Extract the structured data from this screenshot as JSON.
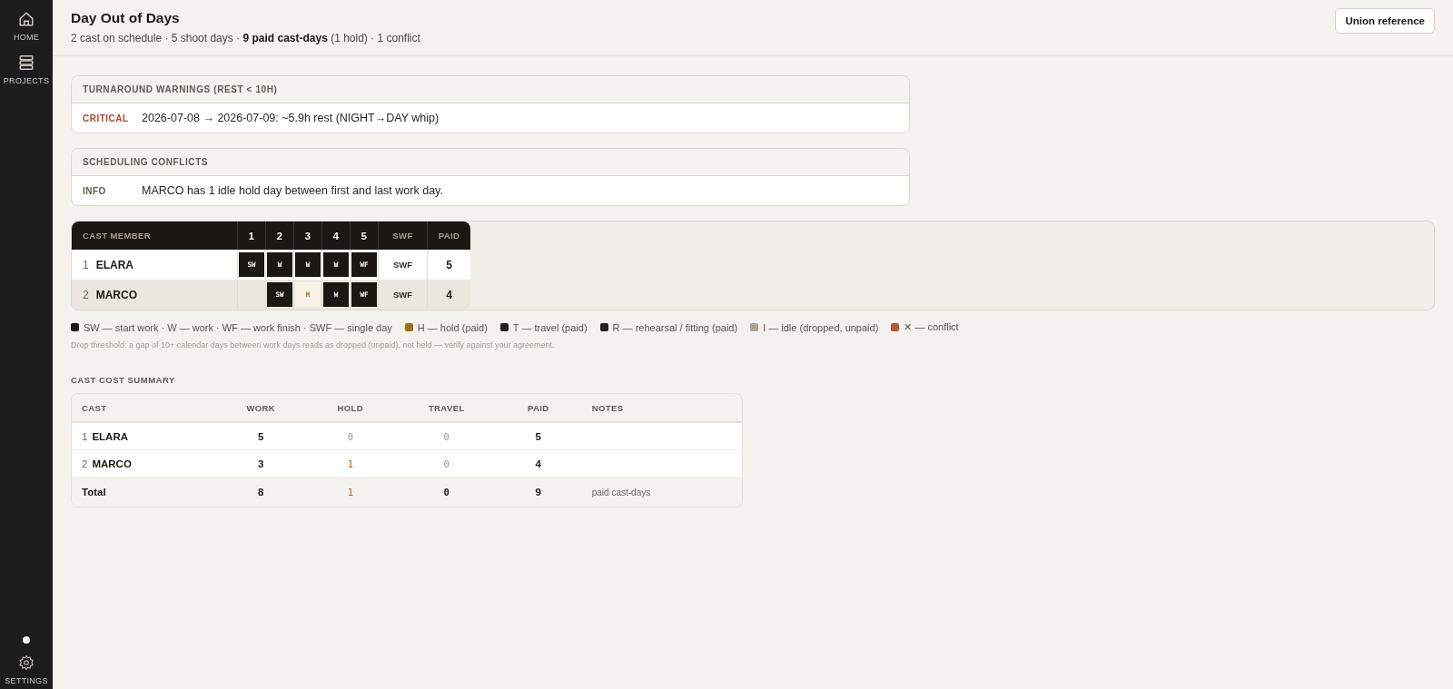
{
  "sidebar": {
    "items": [
      {
        "label": "HOME"
      },
      {
        "label": "PROJECTS"
      }
    ],
    "footer": {
      "label": "SETTINGS"
    }
  },
  "header": {
    "title": "Day Out of Days",
    "subtitle": "2 cast on schedule · 5 shoot days · **9 paid cast-days** (1 hold) · 1 conflict",
    "button": "Union reference"
  },
  "panels": [
    {
      "title": "TURNAROUND WARNINGS (REST < 10H)",
      "rows": [
        {
          "severity": "CRITICAL",
          "kind": "critical",
          "message": "2026-07-08 → 2026-07-09: ~5.9h rest (NIGHT→DAY whip)"
        }
      ]
    },
    {
      "title": "SCHEDULING CONFLICTS",
      "rows": [
        {
          "severity": "INFO",
          "kind": "info",
          "message": "MARCO has 1 idle hold day between first and last work day."
        }
      ]
    }
  ],
  "dood": {
    "columns": [
      "CAST MEMBER",
      "1",
      "2",
      "3",
      "4",
      "5",
      "SWF",
      "PAID"
    ],
    "rows": [
      {
        "num": "1",
        "name": "ELARA",
        "days": [
          {
            "kind": "work",
            "code": "SW"
          },
          {
            "kind": "work",
            "code": "W"
          },
          {
            "kind": "work",
            "code": "W"
          },
          {
            "kind": "work",
            "code": "W"
          },
          {
            "kind": "work",
            "code": "WF"
          }
        ],
        "swf": "SWF",
        "paid": "5"
      },
      {
        "num": "2",
        "name": "MARCO",
        "days": [
          {
            "kind": "empty"
          },
          {
            "kind": "work",
            "code": "SW"
          },
          {
            "kind": "hold",
            "code": "H"
          },
          {
            "kind": "work",
            "code": "W"
          },
          {
            "kind": "work",
            "code": "WF"
          }
        ],
        "swf": "SWF",
        "paid": "4"
      }
    ]
  },
  "legend": [
    {
      "label": "SW — start work · W — work · WF — work finish · SWF — single day",
      "color": "#1a1713"
    },
    {
      "label": "H — hold (paid)",
      "color": "#a26f16"
    },
    {
      "label": "T — travel (paid)",
      "color": "#1f1f1f"
    },
    {
      "label": "R — rehearsal / fitting (paid)",
      "color": "#222222"
    },
    {
      "label": "I — idle (dropped, unpaid)",
      "color": "#a9a196"
    },
    {
      "label": "✕ — conflict",
      "color": "#b4553f"
    }
  ],
  "note": "Drop threshold: a gap of 10+ calendar days between work days reads as dropped (unpaid), not held — verify against your agreement.",
  "summary": {
    "title": "CAST COST SUMMARY",
    "columns": [
      "CAST",
      "WORK",
      "HOLD",
      "TRAVEL",
      "PAID",
      "NOTES"
    ],
    "rows": [
      {
        "cells": [
          {
            "kind": "cast",
            "num": "1",
            "text": "ELARA"
          },
          {
            "text": "5",
            "kind": "count"
          },
          {
            "text": "0",
            "kind": "zero"
          },
          {
            "text": "0",
            "kind": "zero"
          },
          {
            "text": "5",
            "kind": "count"
          }
        ]
      },
      {
        "cells": [
          {
            "kind": "cast",
            "num": "2",
            "text": "MARCO"
          },
          {
            "text": "3",
            "kind": "count"
          },
          {
            "text": "1",
            "kind": "hold"
          },
          {
            "text": "0",
            "kind": "zero"
          },
          {
            "text": "4",
            "kind": "count"
          }
        ]
      },
      {
        "cells": [
          {
            "kind": "total",
            "text": "Total"
          },
          {
            "text": "8",
            "kind": "count"
          },
          {
            "text": "1",
            "kind": "hold"
          },
          {
            "text": "0",
            "kind": "mono"
          },
          {
            "text": "9",
            "kind": "count"
          },
          {
            "kind": "note",
            "text": "paid cast-days"
          }
        ]
      }
    ]
  }
}
